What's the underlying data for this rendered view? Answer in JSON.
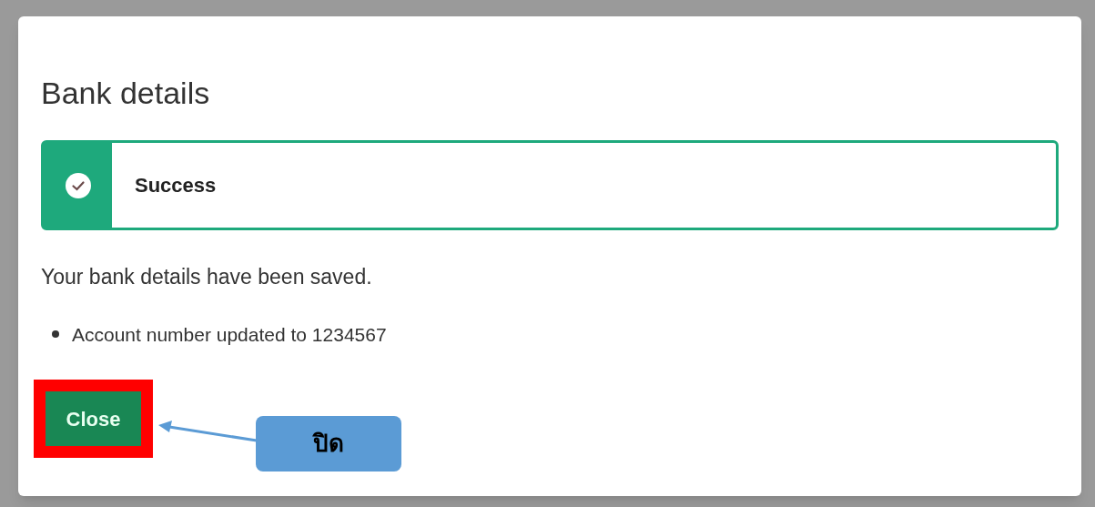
{
  "dialog": {
    "title": "Bank details",
    "alert": {
      "kind": "success",
      "title": "Success"
    },
    "message": "Your bank details have been saved.",
    "items": [
      "Account number updated to 1234567"
    ],
    "buttons": [
      {
        "label": "Close",
        "highlighted": true
      }
    ]
  },
  "annotation": {
    "text": "ปิด"
  }
}
